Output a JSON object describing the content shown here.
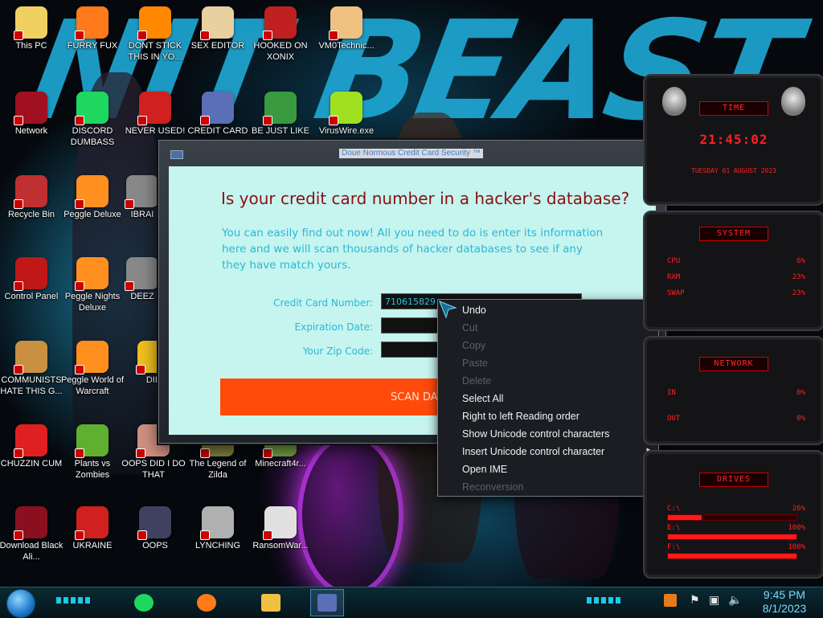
{
  "desktop": {
    "wallpaper_text": "NIT BEAST",
    "icons": [
      {
        "label": "This PC",
        "icon": "this-pc-icon",
        "color": "#f0d060"
      },
      {
        "label": "FURRY FUX",
        "icon": "firefox-icon",
        "color": "#ff7a1a"
      },
      {
        "label": "DONT STICK THIS IN YO...",
        "icon": "vlc-icon",
        "color": "#ff8800"
      },
      {
        "label": "SEX EDITOR",
        "icon": "hxd-icon",
        "color": "#e8d0a0"
      },
      {
        "label": "HOOKED ON XONIX",
        "icon": "xonix-icon",
        "color": "#c02020"
      },
      {
        "label": "VM0Technic...",
        "icon": "doctor-icon",
        "color": "#f0c080"
      },
      {
        "label": "Network",
        "icon": "network-icon",
        "color": "#a01020"
      },
      {
        "label": "DISCORD DUMBASS",
        "icon": "spotify-icon",
        "color": "#1ed760"
      },
      {
        "label": "NEVER USED!",
        "icon": "devcpp-icon",
        "color": "#d02020"
      },
      {
        "label": "CREDIT CARD",
        "icon": "credit-card-icon",
        "color": "#5a6fb8"
      },
      {
        "label": "BE JUST LIKE",
        "icon": "santa-icon",
        "color": "#3a9a40"
      },
      {
        "label": "VirusWire.exe",
        "icon": "lime-icon",
        "color": "#a0e020"
      },
      {
        "label": "Recycle Bin",
        "icon": "recycle-bin-icon",
        "color": "#c03030"
      },
      {
        "label": "Peggle Deluxe",
        "icon": "peggle-icon",
        "color": "#ff9020"
      },
      {
        "label": "IBRAI",
        "icon": "ibrai-icon",
        "color": "#888888"
      },
      {
        "label": "Control Panel",
        "icon": "control-panel-icon",
        "color": "#c01818"
      },
      {
        "label": "Peggle Nights Deluxe",
        "icon": "peggle-nights-icon",
        "color": "#ff9020"
      },
      {
        "label": "DEEZ",
        "icon": "deez-icon",
        "color": "#888888"
      },
      {
        "label": "COMMUNISTS HATE THIS G...",
        "icon": "money-bag-icon",
        "color": "#c89040"
      },
      {
        "label": "Peggle World of Warcraft",
        "icon": "peggle-wow-icon",
        "color": "#ff9020"
      },
      {
        "label": "DIE",
        "icon": "die-icon",
        "color": "#f0c020"
      },
      {
        "label": "CHUZZIN CUM",
        "icon": "chuzzle-icon",
        "color": "#e02020"
      },
      {
        "label": "Plants vs Zombies",
        "icon": "pvz-icon",
        "color": "#60b030"
      },
      {
        "label": "OOPS DID I DO THAT",
        "icon": "person-icon",
        "color": "#d09080"
      },
      {
        "label": "The Legend of Zilda",
        "icon": "zelda-icon",
        "color": "#808040"
      },
      {
        "label": "Minecraft4r...",
        "icon": "minecraft-icon",
        "color": "#70a040"
      },
      {
        "label": "Download Black Ali...",
        "icon": "alienware-icon",
        "color": "#8a1020"
      },
      {
        "label": "UKRAINE",
        "icon": "radiation-icon",
        "color": "#d02020"
      },
      {
        "label": "OOPS",
        "icon": "monitor-icon",
        "color": "#404060"
      },
      {
        "label": "LYNCHING",
        "icon": "noose-icon",
        "color": "#b0b0b0"
      },
      {
        "label": "RansomWar...",
        "icon": "skull-icon",
        "color": "#e0e0e0"
      }
    ]
  },
  "dialog": {
    "title": "Doue Normous Credit Card Security ™",
    "headline": "Is your credit card number in a hacker's database?",
    "description": "You can easily find out now! All you need to do is enter its information here and we will scan thousands of hacker databases to see if any they have match yours.",
    "fields": {
      "card_number": {
        "label": "Credit Card Number:",
        "value": "710615829"
      },
      "expiration": {
        "label": "Expiration Date:",
        "value": ""
      },
      "zip": {
        "label": "Your Zip Code:",
        "value": ""
      }
    },
    "scan_button": "SCAN DATABASES",
    "accent": "#ff4a0a",
    "client_bg": "#c6f4ef"
  },
  "context_menu": {
    "items": [
      {
        "label": "Undo",
        "enabled": true
      },
      {
        "label": "Cut",
        "enabled": false
      },
      {
        "label": "Copy",
        "enabled": false
      },
      {
        "label": "Paste",
        "enabled": false
      },
      {
        "label": "Delete",
        "enabled": false
      },
      {
        "label": "Select All",
        "enabled": true
      },
      {
        "label": "Right to left Reading order",
        "enabled": true
      },
      {
        "label": "Show Unicode control characters",
        "enabled": true
      },
      {
        "label": "Insert Unicode control character",
        "enabled": true
      },
      {
        "label": "Open IME",
        "enabled": true
      },
      {
        "label": "Reconversion",
        "enabled": false
      }
    ]
  },
  "gadgets": {
    "time": {
      "header": "TIME",
      "time": "21:45:02",
      "date": "TUESDAY 01 AUGUST 2023"
    },
    "system": {
      "header": "SYSTEM",
      "rows": [
        {
          "label": "CPU",
          "value": "6%",
          "level": 0.06
        },
        {
          "label": "RAM",
          "value": "23%",
          "level": 0.23
        },
        {
          "label": "SWAP",
          "value": "23%",
          "level": 0.23
        }
      ]
    },
    "network": {
      "header": "NETWORK",
      "rows": [
        {
          "label": "IN",
          "value": "0%"
        },
        {
          "label": "OUT",
          "value": "0%"
        }
      ]
    },
    "drives": {
      "header": "DRIVES",
      "rows": [
        {
          "label": "C:\\",
          "value": "26%",
          "level": 0.26
        },
        {
          "label": "E:\\",
          "value": "100%",
          "level": 1.0
        },
        {
          "label": "F:\\",
          "value": "100%",
          "level": 1.0
        }
      ]
    }
  },
  "taskbar": {
    "apps": [
      {
        "name": "spotify-icon",
        "active": false
      },
      {
        "name": "firefox-icon",
        "active": false
      },
      {
        "name": "file-explorer-icon",
        "active": false
      },
      {
        "name": "credit-card-app-icon",
        "active": true
      }
    ],
    "tray": [
      "flag-icon",
      "network-icon",
      "volume-icon"
    ],
    "time": "9:45 PM",
    "date": "8/1/2023"
  }
}
